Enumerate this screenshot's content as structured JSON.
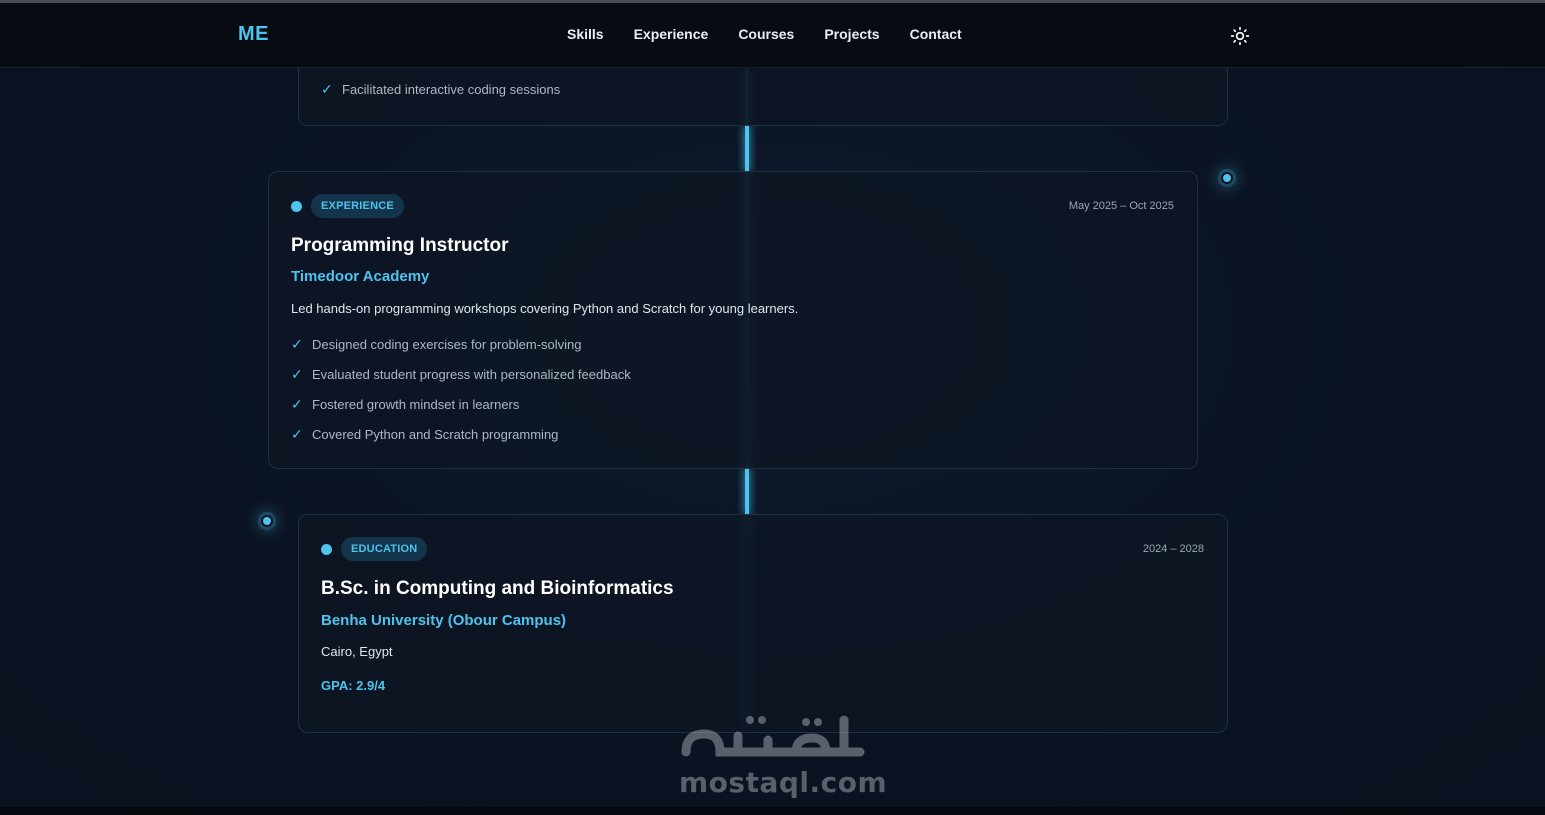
{
  "navbar": {
    "logo": "ME",
    "links": [
      "Skills",
      "Experience",
      "Courses",
      "Projects",
      "Contact"
    ],
    "theme_icon": "sun-icon"
  },
  "previous_card": {
    "bullets": [
      "Facilitated interactive coding sessions"
    ]
  },
  "experience_card": {
    "badge": "EXPERIENCE",
    "date": "May 2025 – Oct 2025",
    "title": "Programming Instructor",
    "organization": "Timedoor Academy",
    "description": "Led hands-on programming workshops covering Python and Scratch for young learners.",
    "bullets": [
      "Designed coding exercises for problem-solving",
      "Evaluated student progress with personalized feedback",
      "Fostered growth mindset in learners",
      "Covered Python and Scratch programming"
    ]
  },
  "education_card": {
    "badge": "EDUCATION",
    "date": "2024 – 2028",
    "title": "B.Sc. in Computing and Bioinformatics",
    "organization": "Benha University (Obour Campus)",
    "location": "Cairo, Egypt",
    "gpa": "GPA: 2.9/4"
  },
  "watermark": {
    "latin": "mostaql.com"
  },
  "check_symbol": "✓",
  "colors": {
    "accent": "#4ec3ee",
    "background": "#0b1220",
    "card_border": "#1f3042"
  }
}
